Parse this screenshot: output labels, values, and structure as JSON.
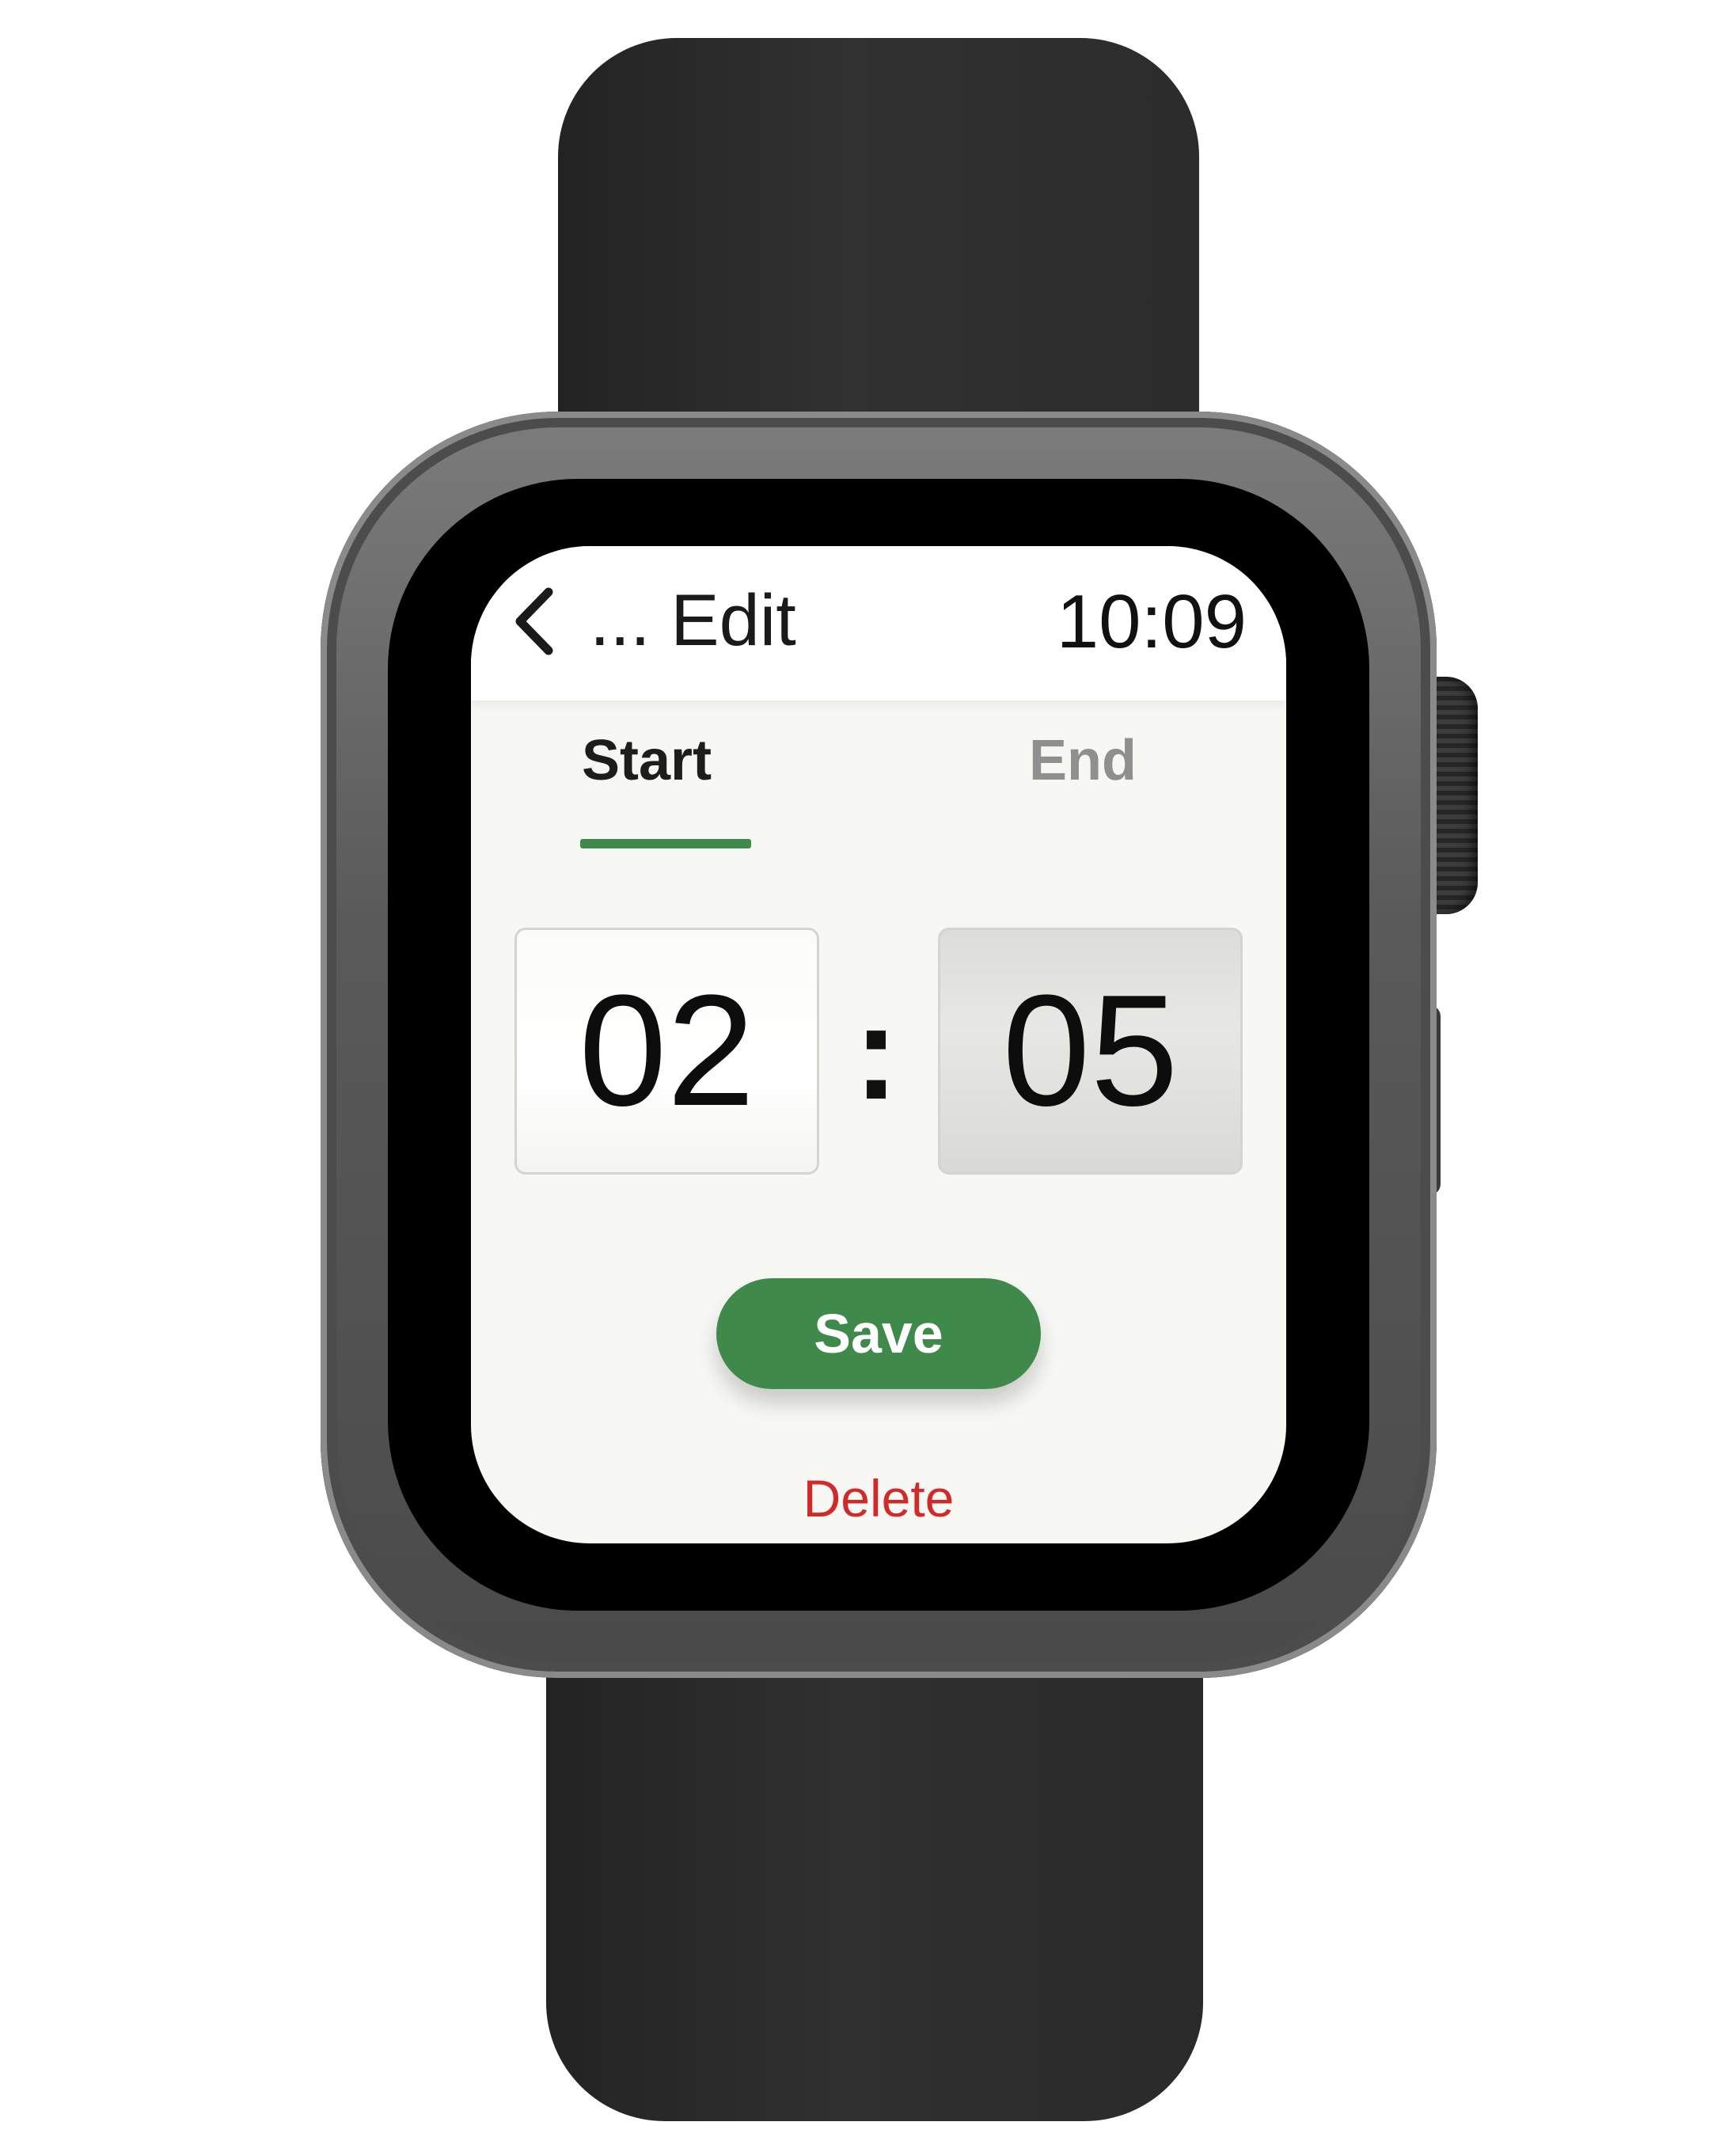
{
  "header": {
    "title": "... Edit",
    "time": "10:09",
    "back_icon": "chevron-left-icon"
  },
  "tabs": [
    {
      "label": "Start",
      "active": true
    },
    {
      "label": "End",
      "active": false
    }
  ],
  "time_picker": {
    "hours": "02",
    "separator": ":",
    "minutes": "05",
    "focused": "minutes"
  },
  "actions": {
    "save_label": "Save",
    "delete_label": "Delete"
  },
  "colors": {
    "accent": "#3f8a4b",
    "destructive": "#d12a2a",
    "screen_background": "#f7f7f3"
  }
}
